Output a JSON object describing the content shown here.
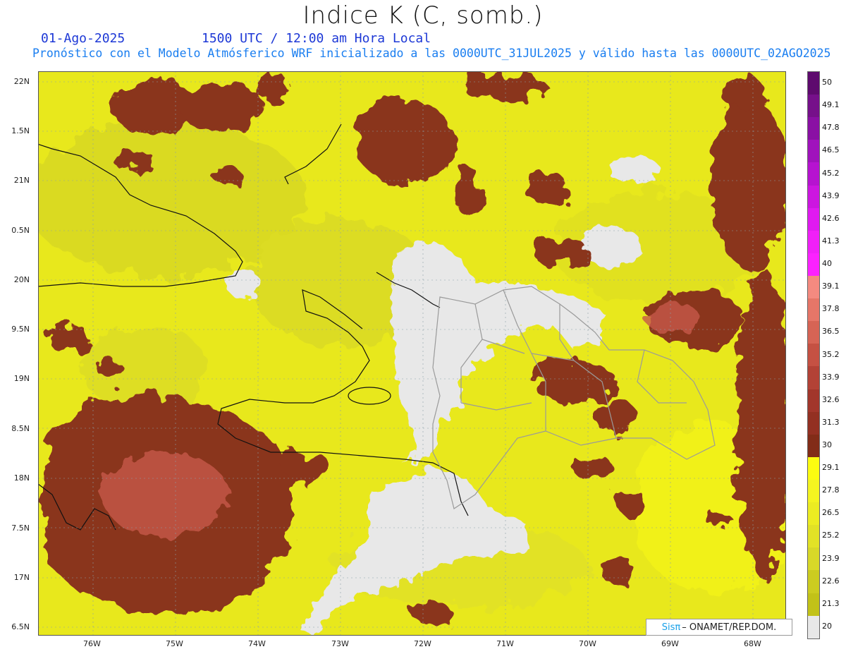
{
  "header": {
    "title": "Indice K (C, somb.)",
    "date": "01-Ago-2025",
    "time": "1500 UTC / 12:00 am Hora Local",
    "info": "Pronóstico con el Modelo Atmósferico WRF inicializado a las 0000UTC_31JUL2025 y válido hasta las  0000UTC_02AGO2025"
  },
  "axes": {
    "lat_labels": [
      "22N",
      "1.5N",
      "21N",
      "0.5N",
      "20N",
      "9.5N",
      "19N",
      "8.5N",
      "18N",
      "7.5N",
      "17N",
      "6.5N"
    ],
    "lon_labels": [
      "76W",
      "75W",
      "74W",
      "73W",
      "72W",
      "71W",
      "70W",
      "69W",
      "68W"
    ]
  },
  "colorbar": {
    "labels": [
      "50",
      "49.1",
      "47.8",
      "46.5",
      "45.2",
      "43.9",
      "42.6",
      "41.3",
      "40",
      "39.1",
      "37.8",
      "36.5",
      "35.2",
      "33.9",
      "32.6",
      "31.3",
      "30",
      "29.1",
      "27.8",
      "26.5",
      "25.2",
      "23.9",
      "22.6",
      "21.3",
      "20"
    ],
    "colors": [
      "#5e0a6e",
      "#76108a",
      "#8a10a4",
      "#a012bc",
      "#b613d0",
      "#cc16e0",
      "#e01af0",
      "#f020f8",
      "#fb22ff",
      "#f48a80",
      "#e67668",
      "#d66455",
      "#c55143",
      "#b34236",
      "#a2362b",
      "#933022",
      "#822c18",
      "#fcfc10",
      "#f4f420",
      "#ecec22",
      "#e2e226",
      "#d8d828",
      "#cccc20",
      "#c2c218",
      "#e8e8e8"
    ]
  },
  "credit": {
    "sis": "Sisπ",
    "org": "– ONAMET/REP.DOM."
  }
}
